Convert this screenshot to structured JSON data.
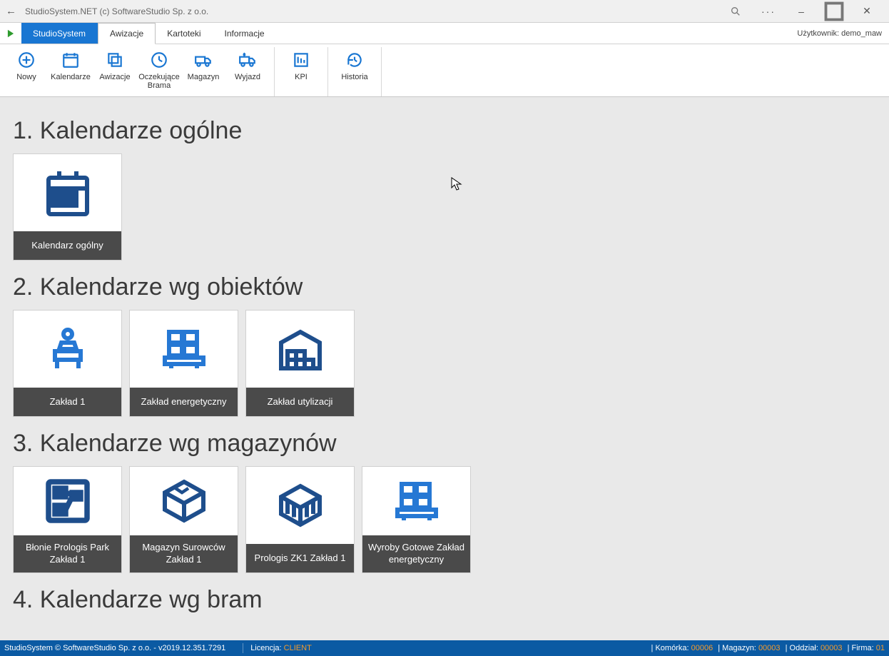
{
  "window": {
    "title": "StudioSystem.NET (c) SoftwareStudio Sp. z o.o."
  },
  "tabs": {
    "studio": "StudioSystem",
    "items": [
      "Awizacje",
      "Kartoteki",
      "Informacje"
    ],
    "active_index": 0,
    "user_label": "Użytkownik:",
    "user_value": "demo_maw"
  },
  "ribbon": {
    "group1": [
      {
        "label": "Nowy"
      },
      {
        "label": "Kalendarze"
      },
      {
        "label": "Awizacje"
      },
      {
        "label": "Oczekujące Brama"
      },
      {
        "label": "Magazyn"
      },
      {
        "label": "Wyjazd"
      }
    ],
    "group2": [
      {
        "label": "KPI"
      }
    ],
    "group3": [
      {
        "label": "Historia"
      }
    ]
  },
  "sections": [
    {
      "heading": "1. Kalendarze ogólne",
      "tiles": [
        {
          "label": "Kalendarz ogólny",
          "icon": "calendar"
        }
      ]
    },
    {
      "heading": "2. Kalendarze wg obiektów",
      "tiles": [
        {
          "label": "Zakład 1",
          "icon": "desk"
        },
        {
          "label": "Zakład energetyczny",
          "icon": "pallet"
        },
        {
          "label": "Zakład utylizacji",
          "icon": "warehouse"
        }
      ]
    },
    {
      "heading": "3. Kalendarze wg magazynów",
      "tiles": [
        {
          "label": "Błonie Prologis Park Zakład 1",
          "icon": "flow"
        },
        {
          "label": "Magazyn Surowców Zakład 1",
          "icon": "box"
        },
        {
          "label": "Prologis ZK1 Zakład 1",
          "icon": "cube"
        },
        {
          "label": "Wyroby Gotowe Zakład energetyczny",
          "icon": "pallet"
        }
      ]
    },
    {
      "heading": "4. Kalendarze wg bram",
      "tiles": []
    }
  ],
  "statusbar": {
    "left1": "StudioSystem © SoftwareStudio Sp. z o.o. - v2019.12.351.7291",
    "licencja_label": "Licencja:",
    "licencja_value": "CLIENT",
    "komorka_label": "Komórka:",
    "komorka_value": "00006",
    "magazyn_label": "Magazyn:",
    "magazyn_value": "00003",
    "oddzial_label": "Oddział:",
    "oddzial_value": "00003",
    "firma_label": "Firma:",
    "firma_value": "01"
  }
}
